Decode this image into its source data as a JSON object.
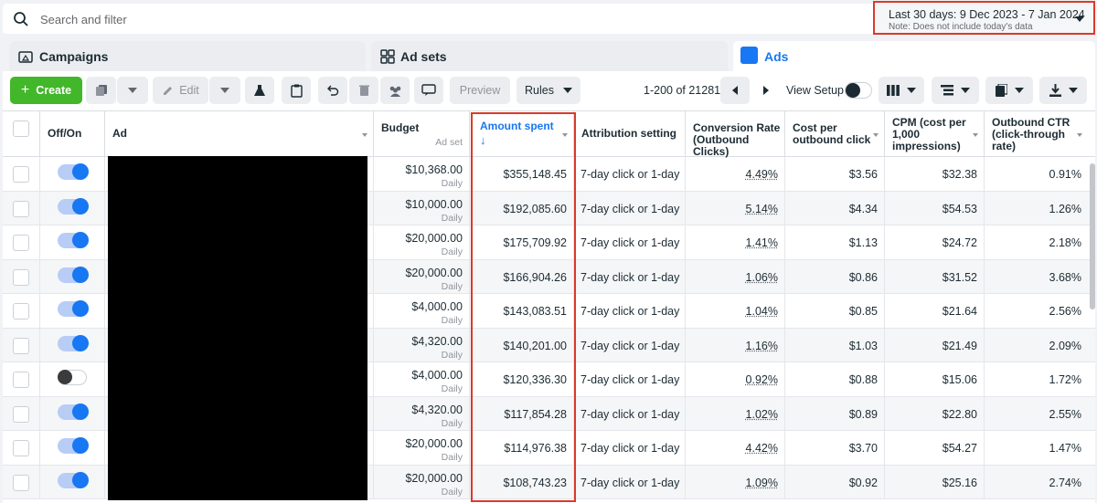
{
  "search": {
    "placeholder": "Search and filter"
  },
  "date_range": {
    "label": "Last 30 days: 9 Dec 2023 - 7 Jan 2024",
    "note": "Note: Does not include today's data"
  },
  "tabs": [
    {
      "label": "Campaigns"
    },
    {
      "label": "Ad sets"
    },
    {
      "label": "Ads",
      "active": true
    }
  ],
  "toolbar": {
    "create_label": "Create",
    "edit_label": "Edit",
    "preview_label": "Preview",
    "rules_label": "Rules",
    "pagination": "1-200 of 21281",
    "view_setup_label": "View Setup"
  },
  "columns": {
    "off_on": "Off/On",
    "ad": "Ad",
    "budget": "Budget",
    "budget_sub": "Ad set",
    "amount_spent": "Amount spent",
    "attribution": "Attribution setting",
    "conversion_rate": "Conversion Rate (Outbound Clicks)",
    "cost_per_click": "Cost per outbound click",
    "cpm": "CPM (cost per 1,000 impressions)",
    "ctr": "Outbound CTR (click-through rate)"
  },
  "rows": [
    {
      "on": true,
      "budget": "$10,368.00",
      "period": "Daily",
      "spent": "$355,148.45",
      "attribution": "7-day click or 1-day ...",
      "conv": "4.49%",
      "cpc": "$3.56",
      "cpm": "$32.38",
      "ctr": "0.91%"
    },
    {
      "on": true,
      "budget": "$10,000.00",
      "period": "Daily",
      "spent": "$192,085.60",
      "attribution": "7-day click or 1-day ...",
      "conv": "5.14%",
      "cpc": "$4.34",
      "cpm": "$54.53",
      "ctr": "1.26%"
    },
    {
      "on": true,
      "budget": "$20,000.00",
      "period": "Daily",
      "spent": "$175,709.92",
      "attribution": "7-day click or 1-day ...",
      "conv": "1.41%",
      "cpc": "$1.13",
      "cpm": "$24.72",
      "ctr": "2.18%"
    },
    {
      "on": true,
      "budget": "$20,000.00",
      "period": "Daily",
      "spent": "$166,904.26",
      "attribution": "7-day click or 1-day ...",
      "conv": "1.06%",
      "cpc": "$0.86",
      "cpm": "$31.52",
      "ctr": "3.68%"
    },
    {
      "on": true,
      "budget": "$4,000.00",
      "period": "Daily",
      "spent": "$143,083.51",
      "attribution": "7-day click or 1-day ...",
      "conv": "1.04%",
      "cpc": "$0.85",
      "cpm": "$21.64",
      "ctr": "2.56%"
    },
    {
      "on": true,
      "budget": "$4,320.00",
      "period": "Daily",
      "spent": "$140,201.00",
      "attribution": "7-day click or 1-day ...",
      "conv": "1.16%",
      "cpc": "$1.03",
      "cpm": "$21.49",
      "ctr": "2.09%"
    },
    {
      "on": false,
      "budget": "$4,000.00",
      "period": "Daily",
      "spent": "$120,336.30",
      "attribution": "7-day click or 1-day ...",
      "conv": "0.92%",
      "cpc": "$0.88",
      "cpm": "$15.06",
      "ctr": "1.72%"
    },
    {
      "on": true,
      "budget": "$4,320.00",
      "period": "Daily",
      "spent": "$117,854.28",
      "attribution": "7-day click or 1-day ...",
      "conv": "1.02%",
      "cpc": "$0.89",
      "cpm": "$22.80",
      "ctr": "2.55%"
    },
    {
      "on": true,
      "budget": "$20,000.00",
      "period": "Daily",
      "spent": "$114,976.38",
      "attribution": "7-day click or 1-day ...",
      "conv": "4.42%",
      "cpc": "$3.70",
      "cpm": "$54.27",
      "ctr": "1.47%"
    },
    {
      "on": true,
      "budget": "$20,000.00",
      "period": "Daily",
      "spent": "$108,743.23",
      "attribution": "7-day click or 1-day ...",
      "conv": "1.09%",
      "cpc": "$0.92",
      "cpm": "$25.16",
      "ctr": "2.74%"
    }
  ],
  "colors": {
    "highlight": "#d93a2b",
    "accent": "#1877f2",
    "create": "#42b72a"
  }
}
